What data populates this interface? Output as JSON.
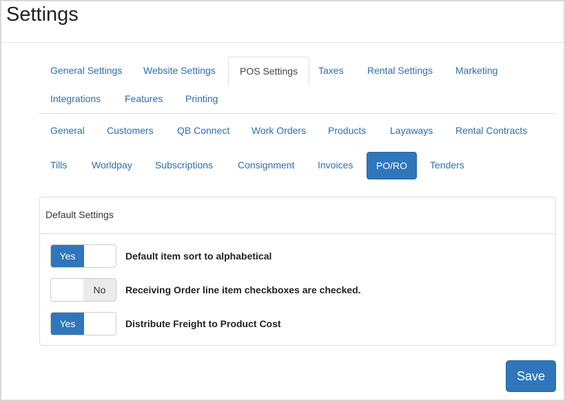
{
  "page_title": "Settings",
  "top_tabs": [
    {
      "label": "General Settings",
      "active": false
    },
    {
      "label": "Website Settings",
      "active": false
    },
    {
      "label": "POS Settings",
      "active": true
    },
    {
      "label": "Taxes",
      "active": false
    },
    {
      "label": "Rental Settings",
      "active": false
    },
    {
      "label": "Marketing",
      "active": false
    },
    {
      "label": "Integrations",
      "active": false
    },
    {
      "label": "Features",
      "active": false
    },
    {
      "label": "Printing",
      "active": false
    }
  ],
  "sub_tabs": [
    {
      "label": "General",
      "active": false
    },
    {
      "label": "Customers",
      "active": false
    },
    {
      "label": "QB Connect",
      "active": false
    },
    {
      "label": "Work Orders",
      "active": false
    },
    {
      "label": "Products",
      "active": false
    },
    {
      "label": "Layaways",
      "active": false
    },
    {
      "label": "Rental Contracts",
      "active": false
    },
    {
      "label": "Tills",
      "active": false
    },
    {
      "label": "Worldpay",
      "active": false
    },
    {
      "label": "Subscriptions",
      "active": false
    },
    {
      "label": "Consignment",
      "active": false
    },
    {
      "label": "Invoices",
      "active": false
    },
    {
      "label": "PO/RO",
      "active": true
    },
    {
      "label": "Tenders",
      "active": false
    }
  ],
  "panel": {
    "title": "Default Settings",
    "settings": [
      {
        "label": "Default item sort to alphabetical",
        "state": "Yes"
      },
      {
        "label": "Receiving Order line item checkboxes are checked.",
        "state": "No"
      },
      {
        "label": "Distribute Freight to Product Cost",
        "state": "Yes"
      }
    ]
  },
  "save_label": "Save",
  "colors": {
    "accent": "#2f76bb",
    "link": "#2a6fb0"
  }
}
